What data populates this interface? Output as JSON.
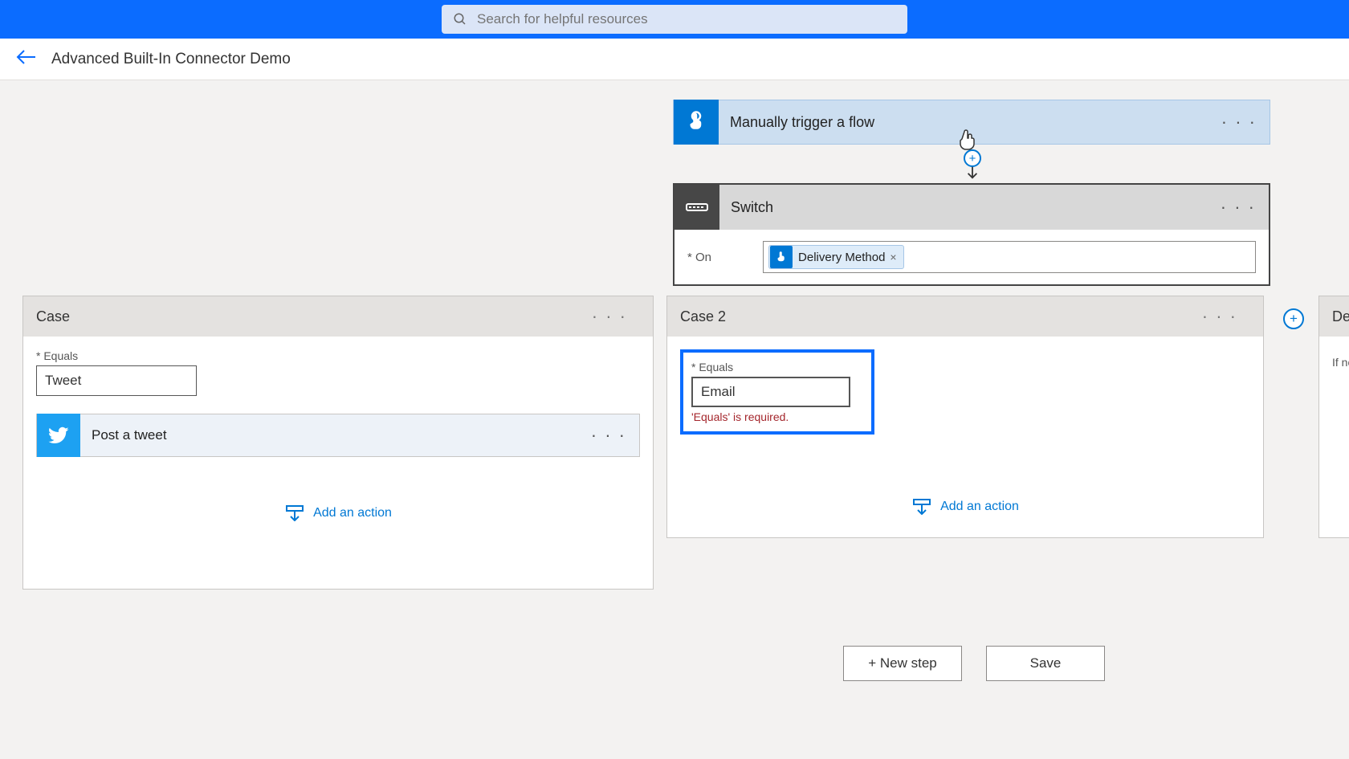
{
  "search": {
    "placeholder": "Search for helpful resources"
  },
  "page": {
    "title": "Advanced Built-In Connector Demo"
  },
  "trigger": {
    "label": "Manually trigger a flow"
  },
  "switch": {
    "label": "Switch",
    "on_label": "On",
    "token": {
      "text": "Delivery Method",
      "remove": "×"
    }
  },
  "case1": {
    "title": "Case",
    "equals_label": "Equals",
    "value": "Tweet",
    "action": {
      "label": "Post a tweet"
    },
    "add_action": "Add an action"
  },
  "case2": {
    "title": "Case 2",
    "equals_label": "Equals",
    "value": "Email",
    "error": "'Equals' is required.",
    "add_action": "Add an action"
  },
  "default_case": {
    "title": "Default",
    "note_prefix": "If no"
  },
  "buttons": {
    "new_step": "+ New step",
    "save": "Save"
  },
  "glyphs": {
    "dots": "· · ·"
  }
}
